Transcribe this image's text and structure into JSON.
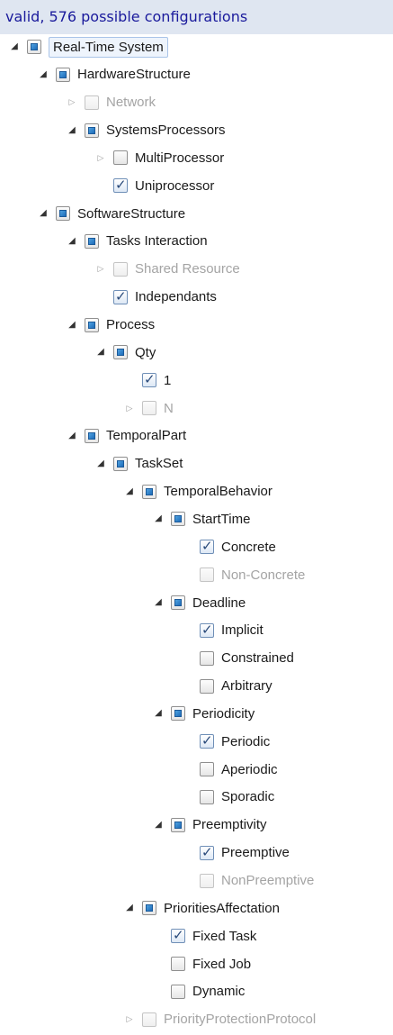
{
  "status": "valid, 576 possible configurations",
  "tree": [
    {
      "label": "Real-Time System",
      "depth": 0,
      "arrow": "open",
      "box": "partial",
      "disabled": false,
      "root": true,
      "icon": "collapse-arrow-icon"
    },
    {
      "label": "HardwareStructure",
      "depth": 1,
      "arrow": "open",
      "box": "partial",
      "disabled": false
    },
    {
      "label": "Network",
      "depth": 2,
      "arrow": "closed",
      "box": "empty",
      "disabled": true
    },
    {
      "label": "SystemsProcessors",
      "depth": 2,
      "arrow": "open",
      "box": "partial",
      "disabled": false
    },
    {
      "label": "MultiProcessor",
      "depth": 3,
      "arrow": "closed",
      "box": "empty",
      "disabled": false
    },
    {
      "label": "Uniprocessor",
      "depth": 3,
      "arrow": "none",
      "box": "checked",
      "disabled": false
    },
    {
      "label": "SoftwareStructure",
      "depth": 1,
      "arrow": "open",
      "box": "partial",
      "disabled": false
    },
    {
      "label": "Tasks Interaction",
      "depth": 2,
      "arrow": "open",
      "box": "partial",
      "disabled": false
    },
    {
      "label": "Shared Resource",
      "depth": 3,
      "arrow": "closed",
      "box": "empty",
      "disabled": true
    },
    {
      "label": "Independants",
      "depth": 3,
      "arrow": "none",
      "box": "checked",
      "disabled": false
    },
    {
      "label": "Process",
      "depth": 2,
      "arrow": "open",
      "box": "partial",
      "disabled": false
    },
    {
      "label": "Qty",
      "depth": 3,
      "arrow": "open",
      "box": "partial",
      "disabled": false
    },
    {
      "label": "1",
      "depth": 4,
      "arrow": "none",
      "box": "checked",
      "disabled": false
    },
    {
      "label": "N",
      "depth": 4,
      "arrow": "closed",
      "box": "empty",
      "disabled": true
    },
    {
      "label": "TemporalPart",
      "depth": 2,
      "arrow": "open",
      "box": "partial",
      "disabled": false
    },
    {
      "label": "TaskSet",
      "depth": 3,
      "arrow": "open",
      "box": "partial",
      "disabled": false
    },
    {
      "label": "TemporalBehavior",
      "depth": 4,
      "arrow": "open",
      "box": "partial",
      "disabled": false
    },
    {
      "label": "StartTime",
      "depth": 5,
      "arrow": "open",
      "box": "partial",
      "disabled": false
    },
    {
      "label": "Concrete",
      "depth": 6,
      "arrow": "none",
      "box": "checked",
      "disabled": false
    },
    {
      "label": "Non-Concrete",
      "depth": 6,
      "arrow": "none",
      "box": "empty",
      "disabled": true
    },
    {
      "label": "Deadline",
      "depth": 5,
      "arrow": "open",
      "box": "partial",
      "disabled": false
    },
    {
      "label": "Implicit",
      "depth": 6,
      "arrow": "none",
      "box": "checked",
      "disabled": false
    },
    {
      "label": "Constrained",
      "depth": 6,
      "arrow": "none",
      "box": "empty",
      "disabled": false
    },
    {
      "label": "Arbitrary",
      "depth": 6,
      "arrow": "none",
      "box": "empty",
      "disabled": false
    },
    {
      "label": "Periodicity",
      "depth": 5,
      "arrow": "open",
      "box": "partial",
      "disabled": false
    },
    {
      "label": "Periodic",
      "depth": 6,
      "arrow": "none",
      "box": "checked",
      "disabled": false
    },
    {
      "label": "Aperiodic",
      "depth": 6,
      "arrow": "none",
      "box": "empty",
      "disabled": false
    },
    {
      "label": "Sporadic",
      "depth": 6,
      "arrow": "none",
      "box": "empty",
      "disabled": false
    },
    {
      "label": "Preemptivity",
      "depth": 5,
      "arrow": "open",
      "box": "partial",
      "disabled": false
    },
    {
      "label": "Preemptive",
      "depth": 6,
      "arrow": "none",
      "box": "checked",
      "disabled": false
    },
    {
      "label": "NonPreemptive",
      "depth": 6,
      "arrow": "none",
      "box": "empty",
      "disabled": true
    },
    {
      "label": "PrioritiesAffectation",
      "depth": 4,
      "arrow": "open",
      "box": "partial",
      "disabled": false
    },
    {
      "label": "Fixed Task",
      "depth": 5,
      "arrow": "none",
      "box": "checked",
      "disabled": false
    },
    {
      "label": "Fixed Job",
      "depth": 5,
      "arrow": "none",
      "box": "empty",
      "disabled": false
    },
    {
      "label": "Dynamic",
      "depth": 5,
      "arrow": "none",
      "box": "empty",
      "disabled": false
    },
    {
      "label": "PriorityProtectionProtocol",
      "depth": 4,
      "arrow": "closed",
      "box": "empty",
      "disabled": true
    }
  ]
}
